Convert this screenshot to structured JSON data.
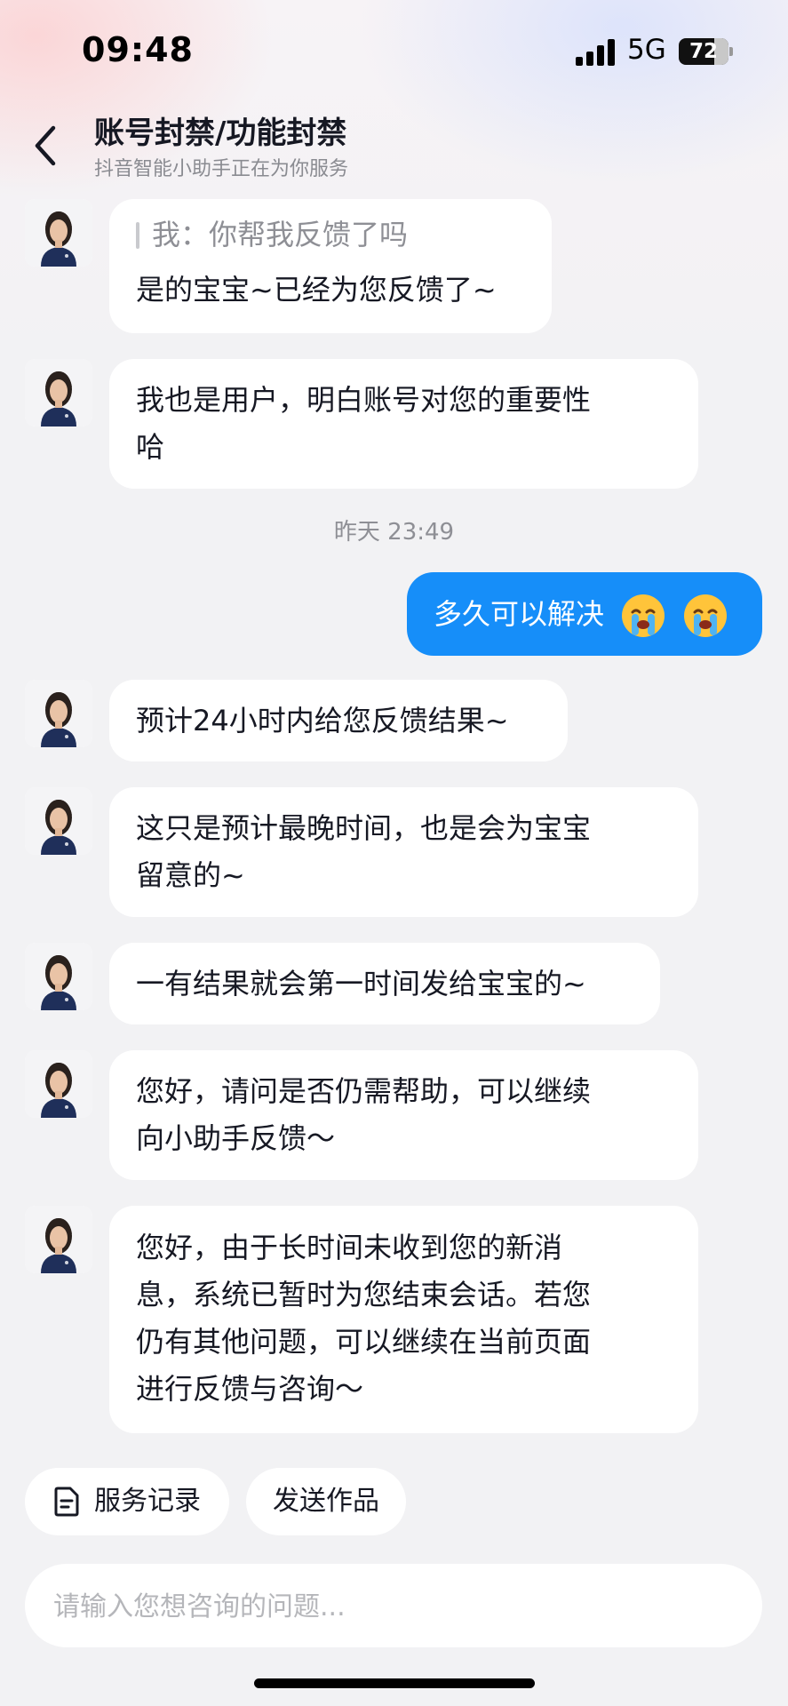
{
  "status_bar": {
    "time": "09:48",
    "network": "5G",
    "battery": "72",
    "battery_level": 0.72
  },
  "header": {
    "title": "账号封禁/功能封禁",
    "subtitle": "抖音智能小助手正在为你服务"
  },
  "messages": [
    {
      "sender": "assistant",
      "quote": "我：你帮我反馈了吗",
      "lines": [
        "是的宝宝~已经为您反馈了~"
      ]
    },
    {
      "sender": "assistant",
      "lines": [
        "我也是用户，明白账号对您的重要性",
        "哈"
      ]
    },
    {
      "sender": "system",
      "text": "昨天 23:49"
    },
    {
      "sender": "user",
      "text": "多久可以解决",
      "emojis": [
        "crying-face",
        "crying-face"
      ]
    },
    {
      "sender": "assistant",
      "lines": [
        "预计24小时内给您反馈结果~"
      ]
    },
    {
      "sender": "assistant",
      "lines": [
        "这只是预计最晚时间，也是会为宝宝",
        "留意的~"
      ]
    },
    {
      "sender": "assistant",
      "lines": [
        "一有结果就会第一时间发给宝宝的~"
      ]
    },
    {
      "sender": "assistant",
      "lines": [
        "您好，请问是否仍需帮助，可以继续",
        "向小助手反馈～"
      ]
    },
    {
      "sender": "assistant",
      "lines": [
        "您好，由于长时间未收到您的新消",
        "息，系统已暂时为您结束会话。若您",
        "仍有其他问题，可以继续在当前页面",
        "进行反馈与咨询～"
      ]
    }
  ],
  "quick_actions": [
    {
      "label": "服务记录",
      "icon": "document-icon"
    },
    {
      "label": "发送作品"
    }
  ],
  "input": {
    "placeholder": "请输入您想咨询的问题..."
  },
  "colors": {
    "user_bubble": "#168ef9",
    "assistant_bubble": "#ffffff",
    "background": "#f2f2f4"
  }
}
